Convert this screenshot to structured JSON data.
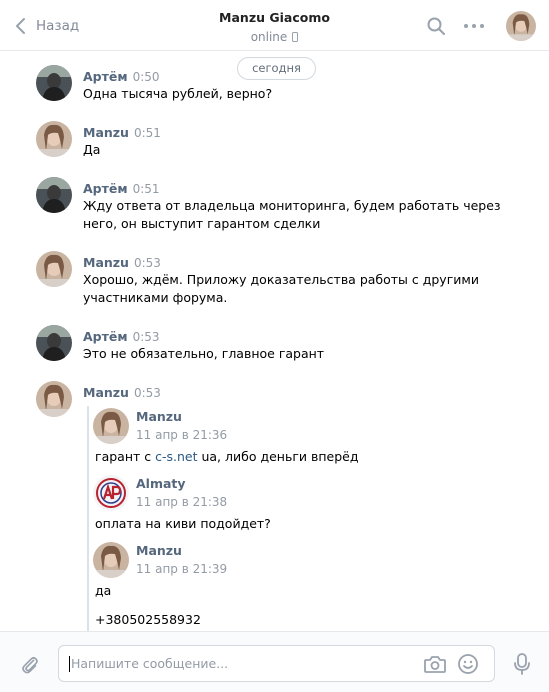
{
  "header": {
    "back_label": "Назад",
    "title": "Manzu Giacomo",
    "status": "online"
  },
  "date_divider": "сегодня",
  "messages": [
    {
      "author": "Артём",
      "time": "0:50",
      "text": "Одна тысяча рублей, верно?"
    },
    {
      "author": "Manzu",
      "time": "0:51",
      "text": "Да"
    },
    {
      "author": "Артём",
      "time": "0:51",
      "text_line1": "Жду ответа от владельца мониторинга, будем работать через",
      "text_line2": "него, он выступит гарантом сделки"
    },
    {
      "author": "Manzu",
      "time": "0:53",
      "text_line1": "Хорошо, ждём. Приложу доказательства работы с другими",
      "text_line2": "участниками форума."
    },
    {
      "author": "Артём",
      "time": "0:53",
      "text": "Это не обязательно, главное гарант"
    },
    {
      "author": "Manzu",
      "time": "0:53"
    }
  ],
  "forwarded": [
    {
      "author": "Manzu",
      "time": "11 апр в 21:36",
      "text_before": "гарант с ",
      "link": "c-s.net",
      "text_after": " ua, либо деньги вперёд"
    },
    {
      "author": "Almaty",
      "time": "11 апр в 21:38",
      "text": "оплата на киви подойдет?"
    },
    {
      "author": "Manzu",
      "time": "11 апр в 21:39",
      "text": "да",
      "text2": "+380502558932"
    }
  ],
  "composer": {
    "placeholder": "Напишите сообщение..."
  },
  "icons": {
    "back": "chevron-left-icon",
    "search": "search-icon",
    "more": "more-icon",
    "attach": "paperclip-icon",
    "camera": "camera-icon",
    "emoji": "smile-icon",
    "mic": "microphone-icon"
  },
  "colors": {
    "author": "#55677d",
    "link": "#2a5885",
    "muted": "#939ba5",
    "border": "#e7e8ec"
  }
}
